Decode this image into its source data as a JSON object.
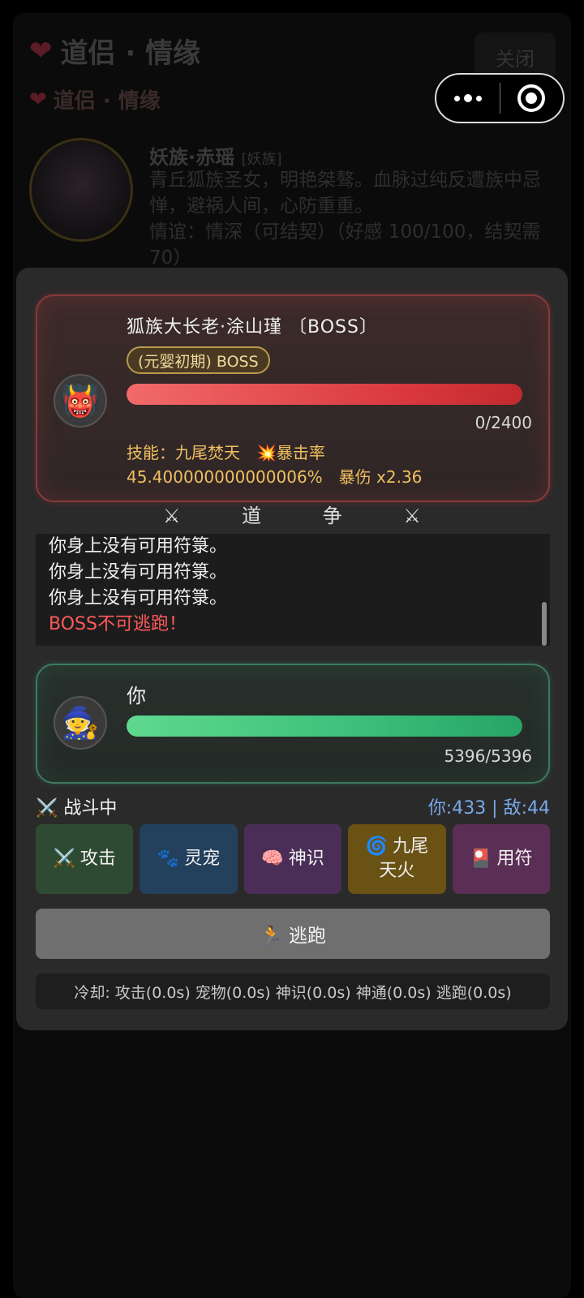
{
  "background": {
    "title": "道侣 · 情缘",
    "close_label": "关闭",
    "subtitle": "道侣 · 情缘",
    "companion_name": "妖族·赤瑶",
    "companion_tag": "[妖族]",
    "companion_desc": "青丘狐族圣女，明艳桀骜。血脉过纯反遭族中忌惮，避祸人间，心防重重。",
    "companion_status": "情谊：情深（可结契）（好感 100/100，结契需 70）"
  },
  "boss": {
    "name": "狐族大长老·涂山瑾 〔BOSS〕",
    "realm_badge": "(元婴初期) BOSS",
    "avatar_icon": "oni-face-icon",
    "hp_text": "0/2400",
    "hp_fraction": 1.0,
    "skill_line": "技能：九尾焚天　💥暴击率 45.400000000000006%　暴伤 x2.36"
  },
  "divider": "⚔ 道 争 ⚔",
  "battle_log": [
    {
      "text": "你身上没有可用符箓。",
      "type": "normal"
    },
    {
      "text": "你身上没有可用符箓。",
      "type": "normal"
    },
    {
      "text": "你身上没有可用符箓。",
      "type": "normal"
    },
    {
      "text": "BOSS不可逃跑！",
      "type": "warn"
    }
  ],
  "player": {
    "name": "你",
    "avatar_icon": "wizard-icon",
    "hp_text": "5396/5396",
    "hp_fraction": 1.0
  },
  "status": {
    "state": "⚔️ 战斗中",
    "score": "你:433 | 敌:44"
  },
  "actions": [
    {
      "id": "attack",
      "icon": "⚔️",
      "label": "攻击"
    },
    {
      "id": "pet",
      "icon": "🐾",
      "label": "灵宠"
    },
    {
      "id": "sense",
      "icon": "🧠",
      "label": "神识"
    },
    {
      "id": "skill",
      "icon": "🌀",
      "label": "九尾天火"
    },
    {
      "id": "talisman",
      "icon": "🎴",
      "label": "用符"
    }
  ],
  "flee_label": "🏃 逃跑",
  "cooldown_text": "冷却: 攻击(0.0s) 宠物(0.0s) 神识(0.0s) 神通(0.0s) 逃跑(0.0s)",
  "colors": {
    "boss_bar": "#d9393e",
    "player_bar": "#3bbf7a",
    "skill_text": "#f0c060",
    "score_text": "#7aa8e8",
    "warn_text": "#ff5a5a"
  }
}
